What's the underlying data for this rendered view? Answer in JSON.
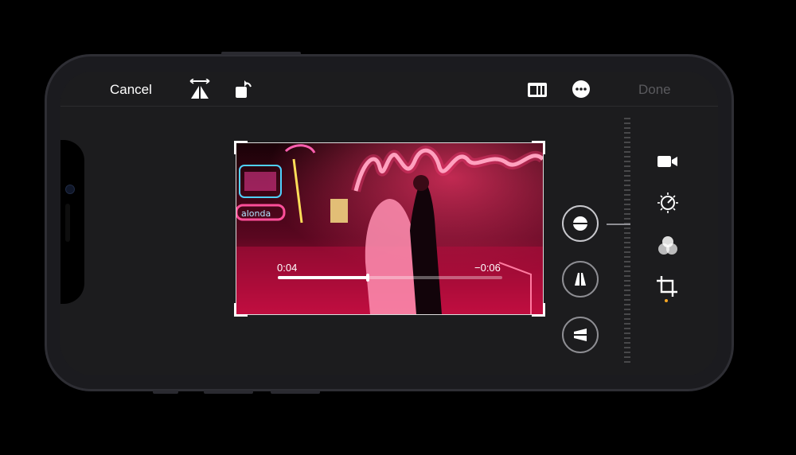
{
  "toolbar": {
    "cancel_label": "Cancel",
    "done_label": "Done",
    "icons": [
      "flip-icon",
      "rotate-icon",
      "aspect-ratio-icon",
      "more-icon"
    ]
  },
  "video": {
    "elapsed": "0:04",
    "remaining": "−0:06",
    "progress": 0.4
  },
  "adjust_tools": [
    "straighten-icon",
    "vertical-perspective-icon",
    "horizontal-perspective-icon"
  ],
  "sidebar_tools": [
    "video-icon",
    "adjust-icon",
    "filters-icon",
    "crop-icon"
  ],
  "colors": {
    "accent": "#f5a623",
    "background": "#1c1c1e",
    "neon": "#ff2a6d"
  }
}
